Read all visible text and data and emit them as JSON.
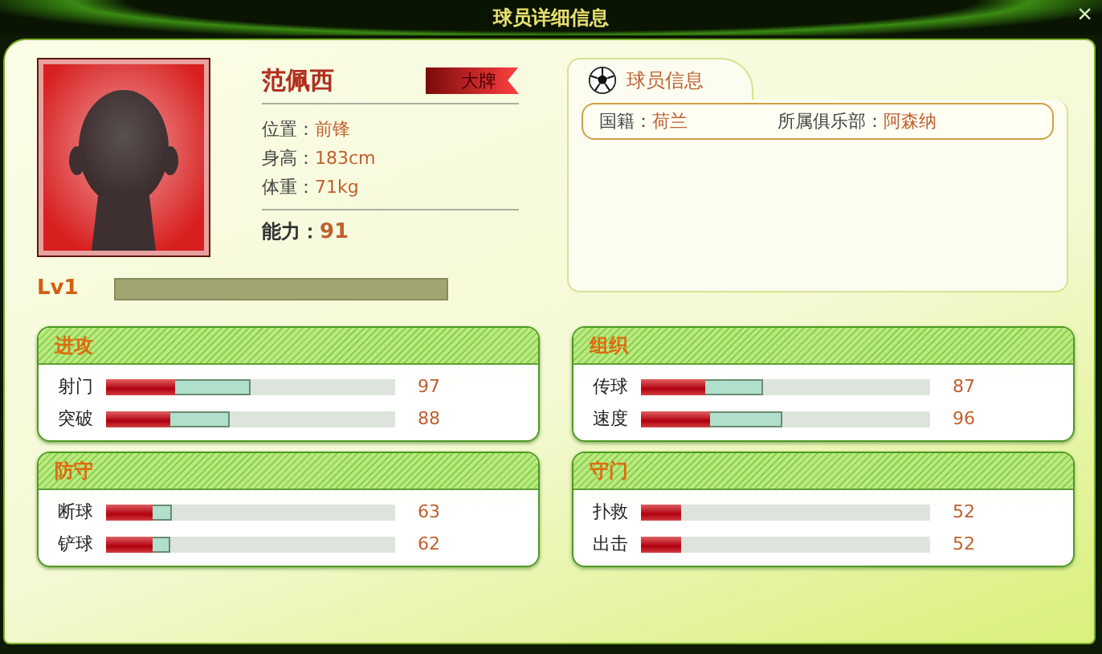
{
  "window": {
    "title": "球员详细信息",
    "close": "×"
  },
  "player": {
    "name": "范佩西",
    "badge": "大牌",
    "details": [
      {
        "label": "位置：",
        "value": "前锋"
      },
      {
        "label": "身高：",
        "value": "183cm"
      },
      {
        "label": "体重：",
        "value": "71kg"
      }
    ],
    "ability": {
      "label": "能力：",
      "value": "91"
    },
    "level": "Lv1"
  },
  "info_panel": {
    "tab": "球员信息",
    "fields": [
      {
        "label": "国籍：",
        "value": "荷兰"
      },
      {
        "label": "所属俱乐部：",
        "value": "阿森纳"
      }
    ]
  },
  "groups": [
    {
      "title": "进攻",
      "stats": [
        {
          "name": "射门",
          "level": 0.24,
          "bonus": {
            "level": 0.5
          },
          "value": "97"
        },
        {
          "name": "突破",
          "level": 0.22,
          "bonus": {
            "level": 0.43
          },
          "value": "88"
        }
      ]
    },
    {
      "title": "组织",
      "stats": [
        {
          "name": "传球",
          "level": 0.22,
          "bonus": {
            "level": 0.42
          },
          "value": "87"
        },
        {
          "name": "速度",
          "level": 0.24,
          "bonus": {
            "level": 0.49
          },
          "value": "96"
        }
      ]
    },
    {
      "title": "防守",
      "stats": [
        {
          "name": "断球",
          "level": 0.16,
          "bonus": {
            "level": 0.23
          },
          "value": "63"
        },
        {
          "name": "铲球",
          "level": 0.16,
          "bonus": {
            "level": 0.22
          },
          "value": "62"
        }
      ]
    },
    {
      "title": "守门",
      "stats": [
        {
          "name": "扑救",
          "level": 0.14,
          "value": "52"
        },
        {
          "name": "出击",
          "level": 0.14,
          "value": "52"
        }
      ]
    }
  ]
}
